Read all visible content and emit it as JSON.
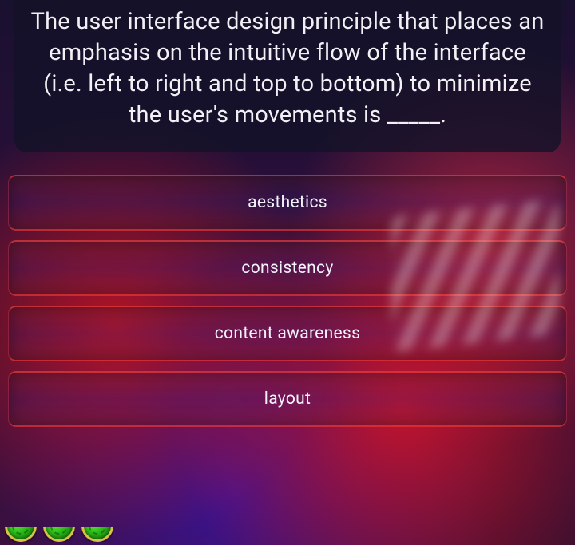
{
  "question": {
    "text": "The user interface design principle that places an emphasis on the intuitive flow of the interface (i.e. left to right and top to bottom) to minimize the user's movements is _____."
  },
  "answers": [
    {
      "label": "aesthetics"
    },
    {
      "label": "consistency"
    },
    {
      "label": "content awareness"
    },
    {
      "label": "layout"
    }
  ]
}
